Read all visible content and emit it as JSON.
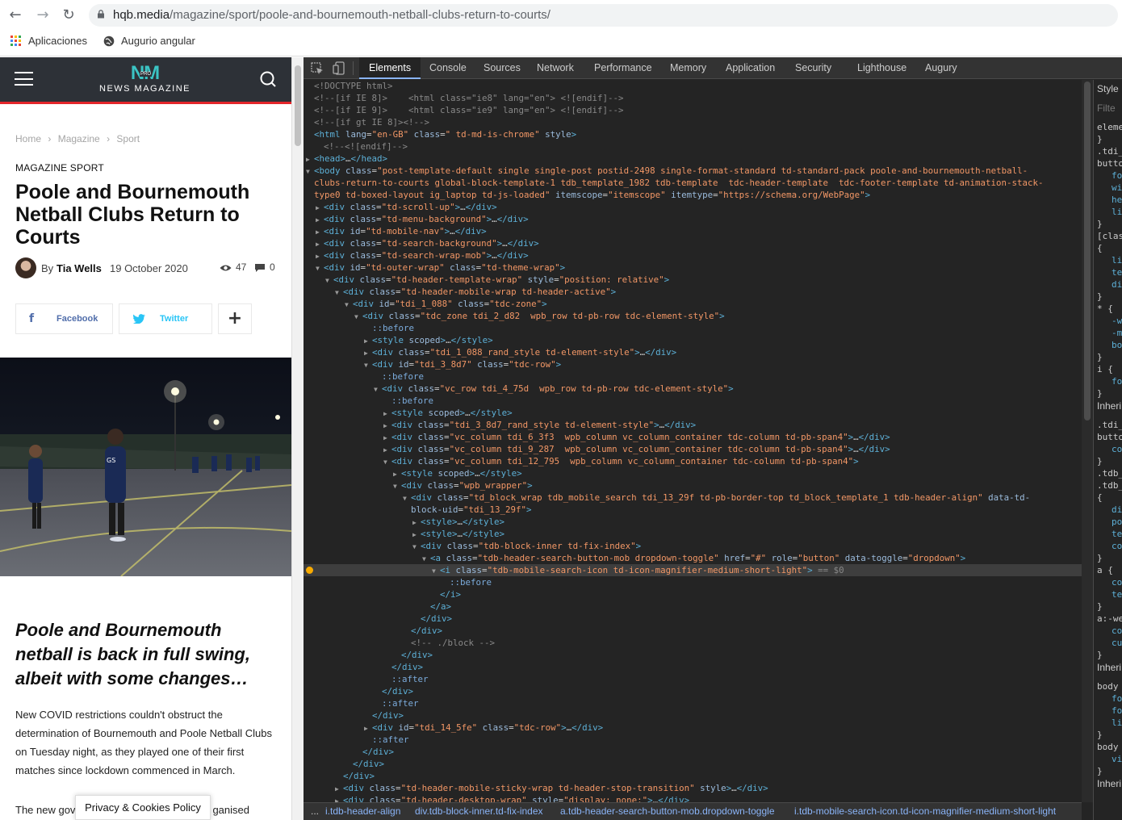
{
  "browser": {
    "url_host": "hqb.media",
    "url_path": "/magazine/sport/poole-and-bournemouth-netball-clubs-return-to-courts/",
    "bookmarks": [
      "Aplicaciones",
      "Augurio angular"
    ]
  },
  "site": {
    "logo_text": "NEWS MAGAZINE",
    "logo_mark": "NM",
    "logo_pro": "PRO",
    "breadcrumb": [
      "Home",
      "Magazine",
      "Sport"
    ],
    "categories": "MAGAZINE SPORT",
    "title": "Poole and Bournemouth Netball Clubs Return to Courts",
    "author_prefix": "By",
    "author": "Tia Wells",
    "date": "19 October 2020",
    "views": "47",
    "comments": "0",
    "share_facebook": "Facebook",
    "share_twitter": "Twitter",
    "lead": "Poole and Bournemouth netball is back in full swing, albeit with some changes…",
    "body_p1": "New COVID restrictions couldn't obstruct the determination of Bournemouth and Poole Netball Clubs on Tuesday night, as they played one of their first matches since lockdown commenced in March.",
    "body_p2_start": "The new gov",
    "body_p2_end": "ganised",
    "cookie_text": "Privacy & Cookies Policy"
  },
  "devtools": {
    "tabs": [
      "Elements",
      "Console",
      "Sources",
      "Network",
      "Performance",
      "Memory",
      "Application",
      "Security",
      "Lighthouse",
      "Augury"
    ],
    "active_tab": "Elements",
    "styles_fragments": [
      "Style",
      "Filte",
      "eleme",
      "}",
      ".tdi_",
      "butto",
      "fo",
      "wi",
      "he",
      "li",
      "}",
      "[clas",
      "{",
      "li",
      "te",
      "di",
      "}",
      "* {",
      "-w",
      "-m",
      "bo",
      "}",
      "i {",
      "fo",
      "}",
      "Inheri",
      ".tdi_",
      "butto",
      "co",
      "}",
      ".tdb_",
      ".tdb_",
      "{",
      "di",
      "po",
      "te",
      "co",
      "}",
      "a {",
      "co",
      "te",
      "}",
      "a:-we",
      "co",
      "cu",
      "}",
      "Inheri",
      "body",
      "fo",
      "fo",
      "li",
      "}",
      "body",
      "vi",
      "}",
      "Inheri"
    ],
    "breadcrumbs": [
      "...",
      "i.tdb-header-align",
      "div.tdb-block-inner.td-fix-index",
      "a.tdb-header-search-button-mob.dropdown-toggle",
      "i.tdb-mobile-search-icon.td-icon-magnifier-medium-short-light"
    ],
    "dom_lines": [
      {
        "i": 0,
        "t": "",
        "h": "<span class='cm'>&lt;!DOCTYPE html&gt;</span>"
      },
      {
        "i": 0,
        "t": "",
        "h": "<span class='cm'>&lt;!--[if IE 8]&gt;    &lt;html class=\"ie8\" lang=\"en\"&gt; &lt;![endif]--&gt;</span>"
      },
      {
        "i": 0,
        "t": "",
        "h": "<span class='cm'>&lt;!--[if IE 9]&gt;    &lt;html class=\"ie9\" lang=\"en\"&gt; &lt;![endif]--&gt;</span>"
      },
      {
        "i": 0,
        "t": "",
        "h": "<span class='cm'>&lt;!--[if gt IE 8]&gt;&lt;!--&gt;</span>"
      },
      {
        "i": 0,
        "t": "",
        "h": "<span class='tg'>&lt;html</span> <span class='at'>lang</span>=<span class='av'>\"en-GB\"</span> <span class='at'>class</span>=<span class='av'>\" td-md-is-chrome\"</span> <span class='at'>style</span><span class='tg'>&gt;</span>"
      },
      {
        "i": 1,
        "t": "",
        "h": "<span class='cm'>&lt;!--&lt;![endif]--&gt;</span>"
      },
      {
        "i": 0,
        "t": "c",
        "h": "<span class='tg'>&lt;head&gt;</span><span class='pl'>…</span><span class='tg'>&lt;/head&gt;</span>"
      },
      {
        "i": 0,
        "t": "o",
        "h": "<span class='tg'>&lt;body</span> <span class='at'>class</span>=<span class='av'>\"post-template-default single single-post postid-2498 single-format-standard td-standard-pack poole-and-bournemouth-netball-</span>"
      },
      {
        "i": 0,
        "t": "",
        "h": "<span class='av'>clubs-return-to-courts global-block-template-1 tdb_template_1982 tdb-template  tdc-header-template  tdc-footer-template td-animation-stack-</span>"
      },
      {
        "i": 0,
        "t": "",
        "h": "<span class='av'>type0 td-boxed-layout ig_laptop td-js-loaded\"</span> <span class='at'>itemscope</span>=<span class='av'>\"itemscope\"</span> <span class='at'>itemtype</span>=<span class='av'>\"https://schema.org/WebPage\"</span><span class='tg'>&gt;</span>"
      },
      {
        "i": 1,
        "t": "c",
        "h": "<span class='tg'>&lt;div</span> <span class='at'>class</span>=<span class='av'>\"td-scroll-up\"</span><span class='tg'>&gt;</span><span class='pl'>…</span><span class='tg'>&lt;/div&gt;</span>"
      },
      {
        "i": 1,
        "t": "c",
        "h": "<span class='tg'>&lt;div</span> <span class='at'>class</span>=<span class='av'>\"td-menu-background\"</span><span class='tg'>&gt;</span><span class='pl'>…</span><span class='tg'>&lt;/div&gt;</span>"
      },
      {
        "i": 1,
        "t": "c",
        "h": "<span class='tg'>&lt;div</span> <span class='at'>id</span>=<span class='av'>\"td-mobile-nav\"</span><span class='tg'>&gt;</span><span class='pl'>…</span><span class='tg'>&lt;/div&gt;</span>"
      },
      {
        "i": 1,
        "t": "c",
        "h": "<span class='tg'>&lt;div</span> <span class='at'>class</span>=<span class='av'>\"td-search-background\"</span><span class='tg'>&gt;</span><span class='pl'>…</span><span class='tg'>&lt;/div&gt;</span>"
      },
      {
        "i": 1,
        "t": "c",
        "h": "<span class='tg'>&lt;div</span> <span class='at'>class</span>=<span class='av'>\"td-search-wrap-mob\"</span><span class='tg'>&gt;</span><span class='pl'>…</span><span class='tg'>&lt;/div&gt;</span>"
      },
      {
        "i": 1,
        "t": "o",
        "h": "<span class='tg'>&lt;div</span> <span class='at'>id</span>=<span class='av'>\"td-outer-wrap\"</span> <span class='at'>class</span>=<span class='av'>\"td-theme-wrap\"</span><span class='tg'>&gt;</span>"
      },
      {
        "i": 2,
        "t": "o",
        "h": "<span class='tg'>&lt;div</span> <span class='at'>class</span>=<span class='av'>\"td-header-template-wrap\"</span> <span class='at'>style</span>=<span class='av'>\"position: relative\"</span><span class='tg'>&gt;</span>"
      },
      {
        "i": 3,
        "t": "o",
        "h": "<span class='tg'>&lt;div</span> <span class='at'>class</span>=<span class='av'>\"td-header-mobile-wrap td-header-active\"</span><span class='tg'>&gt;</span>"
      },
      {
        "i": 4,
        "t": "o",
        "h": "<span class='tg'>&lt;div</span> <span class='at'>id</span>=<span class='av'>\"tdi_1_088\"</span> <span class='at'>class</span>=<span class='av'>\"tdc-zone\"</span><span class='tg'>&gt;</span>"
      },
      {
        "i": 5,
        "t": "o",
        "h": "<span class='tg'>&lt;div</span> <span class='at'>class</span>=<span class='av'>\"tdc_zone tdi_2_d82  wpb_row td-pb-row tdc-element-style\"</span><span class='tg'>&gt;</span>"
      },
      {
        "i": 6,
        "t": "",
        "h": "<span class='ps'>::before</span>"
      },
      {
        "i": 6,
        "t": "c",
        "h": "<span class='tg'>&lt;style</span> <span class='at'>scoped</span><span class='tg'>&gt;</span><span class='pl'>…</span><span class='tg'>&lt;/style&gt;</span>"
      },
      {
        "i": 6,
        "t": "c",
        "h": "<span class='tg'>&lt;div</span> <span class='at'>class</span>=<span class='av'>\"tdi_1_088_rand_style td-element-style\"</span><span class='tg'>&gt;</span><span class='pl'>…</span><span class='tg'>&lt;/div&gt;</span>"
      },
      {
        "i": 6,
        "t": "o",
        "h": "<span class='tg'>&lt;div</span> <span class='at'>id</span>=<span class='av'>\"tdi_3_8d7\"</span> <span class='at'>class</span>=<span class='av'>\"tdc-row\"</span><span class='tg'>&gt;</span>"
      },
      {
        "i": 7,
        "t": "",
        "h": "<span class='ps'>::before</span>"
      },
      {
        "i": 7,
        "t": "o",
        "h": "<span class='tg'>&lt;div</span> <span class='at'>class</span>=<span class='av'>\"vc_row tdi_4_75d  wpb_row td-pb-row tdc-element-style\"</span><span class='tg'>&gt;</span>"
      },
      {
        "i": 8,
        "t": "",
        "h": "<span class='ps'>::before</span>"
      },
      {
        "i": 8,
        "t": "c",
        "h": "<span class='tg'>&lt;style</span> <span class='at'>scoped</span><span class='tg'>&gt;</span><span class='pl'>…</span><span class='tg'>&lt;/style&gt;</span>"
      },
      {
        "i": 8,
        "t": "c",
        "h": "<span class='tg'>&lt;div</span> <span class='at'>class</span>=<span class='av'>\"tdi_3_8d7_rand_style td-element-style\"</span><span class='tg'>&gt;</span><span class='pl'>…</span><span class='tg'>&lt;/div&gt;</span>"
      },
      {
        "i": 8,
        "t": "c",
        "h": "<span class='tg'>&lt;div</span> <span class='at'>class</span>=<span class='av'>\"vc_column tdi_6_3f3  wpb_column vc_column_container tdc-column td-pb-span4\"</span><span class='tg'>&gt;</span><span class='pl'>…</span><span class='tg'>&lt;/div&gt;</span>"
      },
      {
        "i": 8,
        "t": "c",
        "h": "<span class='tg'>&lt;div</span> <span class='at'>class</span>=<span class='av'>\"vc_column tdi_9_287  wpb_column vc_column_container tdc-column td-pb-span4\"</span><span class='tg'>&gt;</span><span class='pl'>…</span><span class='tg'>&lt;/div&gt;</span>"
      },
      {
        "i": 8,
        "t": "o",
        "h": "<span class='tg'>&lt;div</span> <span class='at'>class</span>=<span class='av'>\"vc_column tdi_12_795  wpb_column vc_column_container tdc-column td-pb-span4\"</span><span class='tg'>&gt;</span>"
      },
      {
        "i": 9,
        "t": "c",
        "h": "<span class='tg'>&lt;style</span> <span class='at'>scoped</span><span class='tg'>&gt;</span><span class='pl'>…</span><span class='tg'>&lt;/style&gt;</span>"
      },
      {
        "i": 9,
        "t": "o",
        "h": "<span class='tg'>&lt;div</span> <span class='at'>class</span>=<span class='av'>\"wpb_wrapper\"</span><span class='tg'>&gt;</span>"
      },
      {
        "i": 10,
        "t": "o",
        "h": "<span class='tg'>&lt;div</span> <span class='at'>class</span>=<span class='av'>\"td_block_wrap tdb_mobile_search tdi_13_29f td-pb-border-top td_block_template_1 tdb-header-align\"</span> <span class='at'>data-td-</span>"
      },
      {
        "i": 10,
        "t": "",
        "h": "<span class='at'>block-uid</span>=<span class='av'>\"tdi_13_29f\"</span><span class='tg'>&gt;</span>"
      },
      {
        "i": 11,
        "t": "c",
        "h": "<span class='tg'>&lt;style&gt;</span><span class='pl'>…</span><span class='tg'>&lt;/style&gt;</span>"
      },
      {
        "i": 11,
        "t": "c",
        "h": "<span class='tg'>&lt;style&gt;</span><span class='pl'>…</span><span class='tg'>&lt;/style&gt;</span>"
      },
      {
        "i": 11,
        "t": "o",
        "h": "<span class='tg'>&lt;div</span> <span class='at'>class</span>=<span class='av'>\"tdb-block-inner td-fix-index\"</span><span class='tg'>&gt;</span>"
      },
      {
        "i": 12,
        "t": "o",
        "h": "<span class='tg'>&lt;a</span> <span class='at'>class</span>=<span class='av'>\"tdb-header-search-button-mob dropdown-toggle\"</span> <span class='at'>href</span>=<span class='av'>\"#\"</span> <span class='at'>role</span>=<span class='av'>\"button\"</span> <span class='at'>data-toggle</span>=<span class='av'>\"dropdown\"</span><span class='tg'>&gt;</span>"
      },
      {
        "i": 13,
        "t": "o",
        "sel": true,
        "h": "<span class='tg'>&lt;i</span> <span class='at'>class</span>=<span class='av'>\"tdb-mobile-search-icon td-icon-magnifier-medium-short-light\"</span><span class='tg'>&gt;</span> <span class='cm'>== $0</span>"
      },
      {
        "i": 14,
        "t": "",
        "h": "<span class='ps'>::before</span>"
      },
      {
        "i": 13,
        "t": "",
        "h": "<span class='tg'>&lt;/i&gt;</span>"
      },
      {
        "i": 12,
        "t": "",
        "h": "<span class='tg'>&lt;/a&gt;</span>"
      },
      {
        "i": 11,
        "t": "",
        "h": "<span class='tg'>&lt;/div&gt;</span>"
      },
      {
        "i": 10,
        "t": "",
        "h": "<span class='tg'>&lt;/div&gt;</span>"
      },
      {
        "i": 10,
        "t": "",
        "h": "<span class='cm'>&lt;!-- ./block --&gt;</span>"
      },
      {
        "i": 9,
        "t": "",
        "h": "<span class='tg'>&lt;/div&gt;</span>"
      },
      {
        "i": 8,
        "t": "",
        "h": "<span class='tg'>&lt;/div&gt;</span>"
      },
      {
        "i": 8,
        "t": "",
        "h": "<span class='ps'>::after</span>"
      },
      {
        "i": 7,
        "t": "",
        "h": "<span class='tg'>&lt;/div&gt;</span>"
      },
      {
        "i": 7,
        "t": "",
        "h": "<span class='ps'>::after</span>"
      },
      {
        "i": 6,
        "t": "",
        "h": "<span class='tg'>&lt;/div&gt;</span>"
      },
      {
        "i": 6,
        "t": "c",
        "h": "<span class='tg'>&lt;div</span> <span class='at'>id</span>=<span class='av'>\"tdi_14_5fe\"</span> <span class='at'>class</span>=<span class='av'>\"tdc-row\"</span><span class='tg'>&gt;</span><span class='pl'>…</span><span class='tg'>&lt;/div&gt;</span>"
      },
      {
        "i": 6,
        "t": "",
        "h": "<span class='ps'>::after</span>"
      },
      {
        "i": 5,
        "t": "",
        "h": "<span class='tg'>&lt;/div&gt;</span>"
      },
      {
        "i": 4,
        "t": "",
        "h": "<span class='tg'>&lt;/div&gt;</span>"
      },
      {
        "i": 3,
        "t": "",
        "h": "<span class='tg'>&lt;/div&gt;</span>"
      },
      {
        "i": 3,
        "t": "c",
        "h": "<span class='tg'>&lt;div</span> <span class='at'>class</span>=<span class='av'>\"td-header-mobile-sticky-wrap td-header-stop-transition\"</span> <span class='at'>style</span><span class='tg'>&gt;</span><span class='pl'>…</span><span class='tg'>&lt;/div&gt;</span>"
      },
      {
        "i": 3,
        "t": "c",
        "h": "<span class='tg'>&lt;div</span> <span class='at'>class</span>=<span class='av'>\"td-header-desktop-wrap\"</span> <span class='at'>style</span>=<span class='av'>\"display: none;\"</span><span class='tg'>&gt;</span><span class='pl'>…</span><span class='tg'>&lt;/div&gt;</span>"
      }
    ]
  }
}
